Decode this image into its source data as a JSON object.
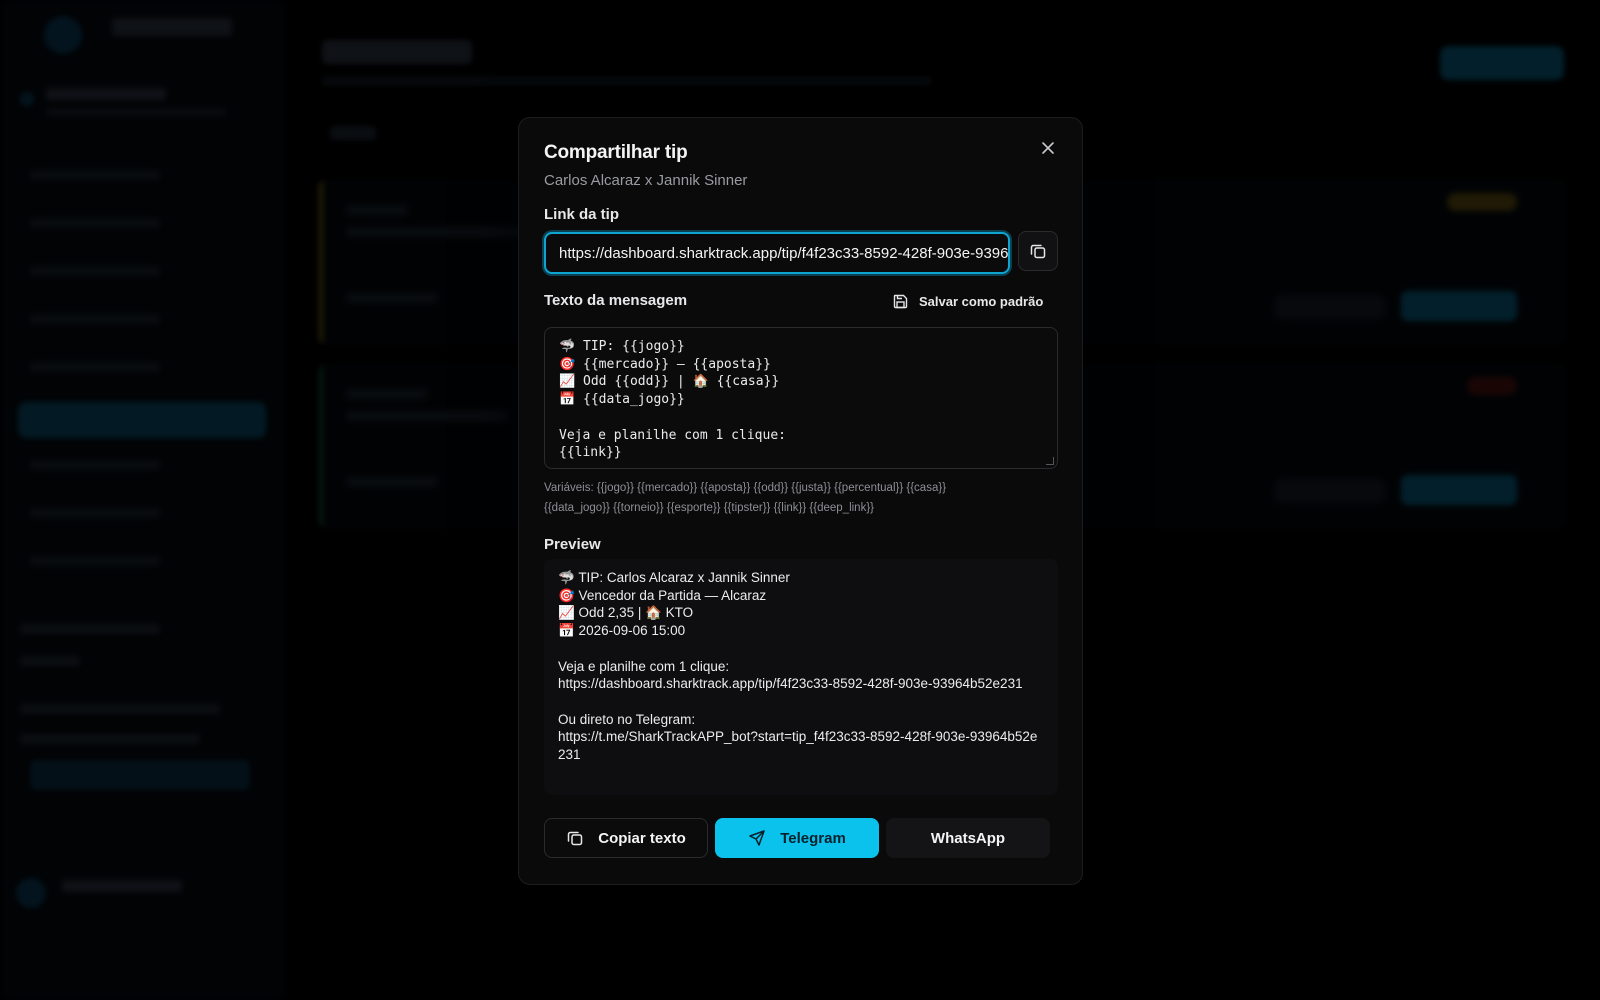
{
  "modal": {
    "title": "Compartilhar tip",
    "subtitle": "Carlos Alcaraz x Jannik Sinner",
    "link_label": "Link da tip",
    "link_value": "https://dashboard.sharktrack.app/tip/f4f23c33-8592-428f-903e-93964b52e231",
    "message_label": "Texto da mensagem",
    "save_default_label": "Salvar como padrão",
    "message_template": "🦈 TIP: {{jogo}}\n🎯 {{mercado}} — {{aposta}}\n📈 Odd {{odd}} | 🏠 {{casa}}\n📅 {{data_jogo}}\n\nVeja e planilhe com 1 clique:\n{{link}}",
    "variables_text": "Variáveis: {{jogo}} {{mercado}} {{aposta}} {{odd}} {{justa}} {{percentual}} {{casa}} {{data_jogo}} {{torneio}} {{esporte}} {{tipster}} {{link}} {{deep_link}}",
    "preview_label": "Preview",
    "preview_text": "🦈 TIP: Carlos Alcaraz x Jannik Sinner\n🎯 Vencedor da Partida — Alcaraz\n📈 Odd 2,35 | 🏠 KTO\n📅 2026-09-06 15:00\n\nVeja e planilhe com 1 clique:\nhttps://dashboard.sharktrack.app/tip/f4f23c33-8592-428f-903e-93964b52e231\n\nOu direto no Telegram:\nhttps://t.me/SharkTrackAPP_bot?start=tip_f4f23c33-8592-428f-903e-93964b52e231",
    "buttons": {
      "copy_text": "Copiar texto",
      "telegram": "Telegram",
      "whatsapp": "WhatsApp"
    }
  },
  "colors": {
    "accent": "#0bc2ec",
    "focus_ring": "#0ea5d0",
    "modal_bg": "#0a0a0b",
    "page_bg": "#000000"
  },
  "icons": [
    "close-icon",
    "copy-icon",
    "save-icon",
    "send-icon"
  ]
}
